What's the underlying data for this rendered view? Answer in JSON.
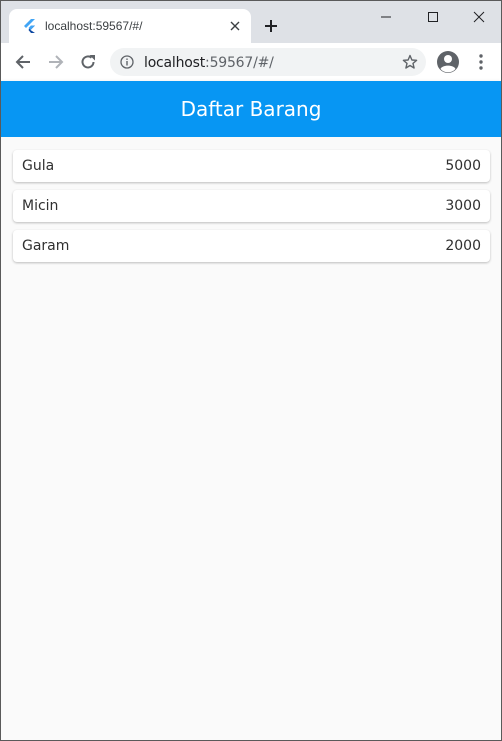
{
  "browser": {
    "tab_title": "localhost:59567/#/",
    "url_host": "localhost",
    "url_rest": ":59567/#/"
  },
  "app": {
    "title": "Daftar Barang",
    "accent_color": "#0796f3",
    "items": [
      {
        "name": "Gula",
        "price": "5000"
      },
      {
        "name": "Micin",
        "price": "3000"
      },
      {
        "name": "Garam",
        "price": "2000"
      }
    ]
  }
}
